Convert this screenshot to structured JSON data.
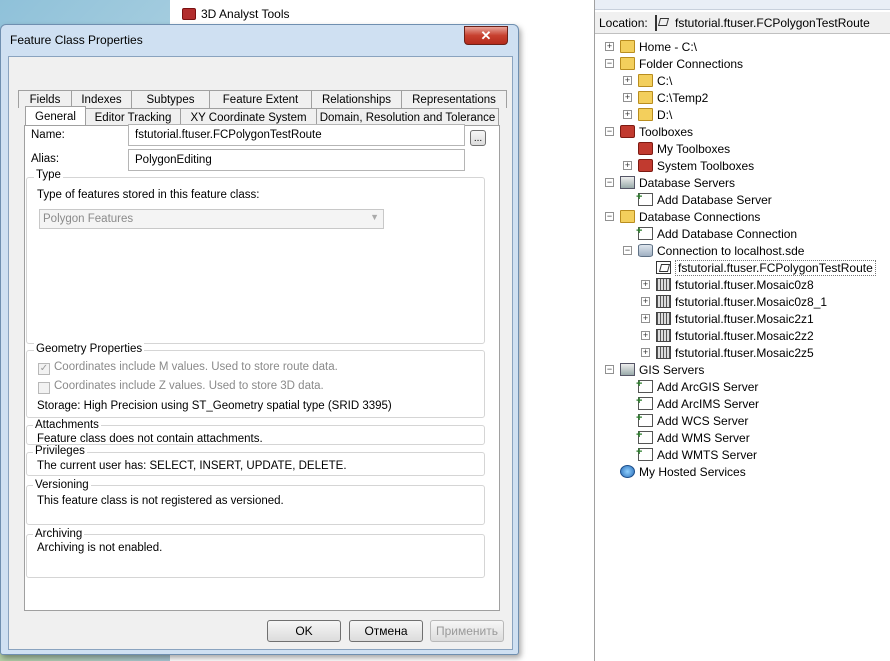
{
  "background": {
    "tree_items": [
      "3D Analyst Tools"
    ]
  },
  "dialog": {
    "title": "Feature Class Properties",
    "close": "✕",
    "tabs_row1": [
      "Fields",
      "Indexes",
      "Subtypes",
      "Feature Extent",
      "Relationships",
      "Representations"
    ],
    "tabs_row2": [
      "General",
      "Editor Tracking",
      "XY Coordinate System",
      "Domain, Resolution and Tolerance"
    ],
    "selected_tab": "General",
    "name_label": "Name:",
    "name_value": "fstutorial.ftuser.FCPolygonTestRoute",
    "browse_label": "...",
    "alias_label": "Alias:",
    "alias_value": "PolygonEditing",
    "type_group": {
      "caption": "Type",
      "description": "Type of features stored in this feature class:",
      "selected": "Polygon Features"
    },
    "geometry_group": {
      "caption": "Geometry Properties",
      "m_values": "Coordinates include M values. Used to store route data.",
      "m_checked": true,
      "z_values": "Coordinates include Z values. Used to store 3D data.",
      "z_checked": false,
      "storage": "Storage: High Precision using ST_Geometry spatial type (SRID 3395)"
    },
    "attachments": {
      "caption": "Attachments",
      "text": "Feature class does not contain attachments."
    },
    "privileges": {
      "caption": "Privileges",
      "text": "The current user has: SELECT, INSERT, UPDATE, DELETE."
    },
    "versioning": {
      "caption": "Versioning",
      "text": "This feature class is not registered as versioned."
    },
    "archiving": {
      "caption": "Archiving",
      "text": "Archiving is not enabled."
    },
    "buttons": {
      "ok": "OK",
      "cancel": "Отмена",
      "apply": "Применить"
    }
  },
  "catalog": {
    "location_label": "Location:",
    "location_value": "fstutorial.ftuser.FCPolygonTestRoute",
    "tree": [
      {
        "label": "Home - C:\\",
        "icon": "folder-icon",
        "expander": "+"
      },
      {
        "label": "Folder Connections",
        "icon": "folder-icon",
        "expander": "−"
      },
      {
        "label": "C:\\",
        "icon": "folder-icon",
        "expander": "+"
      },
      {
        "label": "C:\\Temp2",
        "icon": "folder-icon",
        "expander": "+"
      },
      {
        "label": "D:\\",
        "icon": "folder-icon",
        "expander": "+"
      },
      {
        "label": "Toolboxes",
        "icon": "toolbox-icon",
        "expander": "−"
      },
      {
        "label": "My Toolboxes",
        "icon": "toolbox-icon",
        "expander": ""
      },
      {
        "label": "System Toolboxes",
        "icon": "toolbox-icon",
        "expander": "+"
      },
      {
        "label": "Database Servers",
        "icon": "database-server-icon",
        "expander": "−"
      },
      {
        "label": "Add Database Server",
        "icon": "add-icon",
        "expander": ""
      },
      {
        "label": "Database Connections",
        "icon": "folder-icon",
        "expander": "−"
      },
      {
        "label": "Add Database Connection",
        "icon": "add-icon",
        "expander": ""
      },
      {
        "label": "Connection to localhost.sde",
        "icon": "database-icon",
        "expander": "−"
      },
      {
        "label": "fstutorial.ftuser.FCPolygonTestRoute",
        "icon": "feature-class-icon",
        "expander": ""
      },
      {
        "label": "fstutorial.ftuser.Mosaic0z8",
        "icon": "mosaic-icon",
        "expander": "+"
      },
      {
        "label": "fstutorial.ftuser.Mosaic0z8_1",
        "icon": "mosaic-icon",
        "expander": "+"
      },
      {
        "label": "fstutorial.ftuser.Mosaic2z1",
        "icon": "mosaic-icon",
        "expander": "+"
      },
      {
        "label": "fstutorial.ftuser.Mosaic2z2",
        "icon": "mosaic-icon",
        "expander": "+"
      },
      {
        "label": "fstutorial.ftuser.Mosaic2z5",
        "icon": "mosaic-icon",
        "expander": "+"
      },
      {
        "label": "GIS Servers",
        "icon": "server-icon",
        "expander": "−"
      },
      {
        "label": "Add ArcGIS Server",
        "icon": "add-icon",
        "expander": ""
      },
      {
        "label": "Add ArcIMS Server",
        "icon": "add-icon",
        "expander": ""
      },
      {
        "label": "Add WCS Server",
        "icon": "add-icon",
        "expander": ""
      },
      {
        "label": "Add WMS Server",
        "icon": "add-icon",
        "expander": ""
      },
      {
        "label": "Add WMTS Server",
        "icon": "add-icon",
        "expander": ""
      },
      {
        "label": "My Hosted Services",
        "icon": "globe-icon",
        "expander": ""
      }
    ]
  }
}
